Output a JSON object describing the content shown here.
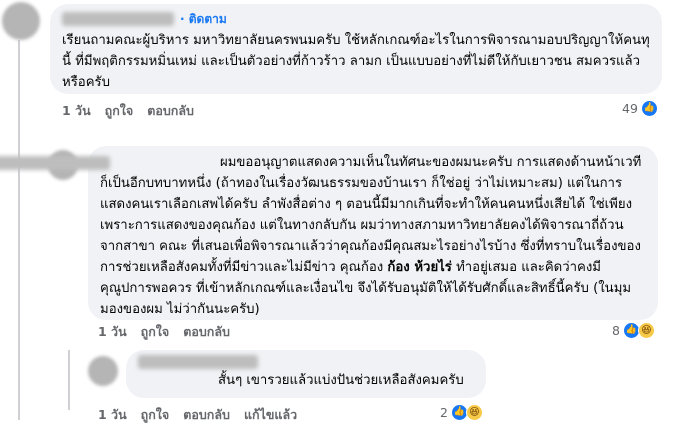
{
  "comments": [
    {
      "follow_label": "· ติดตาม",
      "text": "เรียนถามคณะผู้บริหาร มหาวิทยาลัยนครพนมครับ ใช้หลักเกณฑ์อะไรในการพิจารณามอบปริญญาให้คนทุนี้ ที่มีพฤติกรรมหมิ่นเหม่ และเป็นตัวอย่างที่ก้าวร้าว ลามก เป็นแบบอย่างที่ไม่ดีให้กับเยาวชน สมควรแล้วหรือครับ",
      "time": "1 วัน",
      "like_action": "ถูกใจ",
      "reply_action": "ตอบกลับ",
      "reaction_count": "49"
    },
    {
      "text_before": "ผมขออนุญาตแสดงความเห็นในทัศนะของผมนะครับ การแสดงด้านหน้าเวทีก็เป็นอีกบทบาทหนึ่ง (ถ้าทองในเรื่องวัฒนธรรมของบ้านเรา ก็ใช่อยู่ ว่าไม่เหมาะสม) แต่ในการแสดงคนเราเลือกเสพได้ครับ ลำพังสื่อต่าง ๆ ตอนนี้มีมากเกินที่จะทำให้คนคนหนึ่งเสียได้ ใช่เพียงเพราะการแสดงของคุณก้อง แต่ในทางกลับกัน ผมว่าทางสภามหาวิทยาลัยคงได้พิจารณาถี่ถ้วนจากสาขา คณะ ที่เสนอเพื่อพิจารณาแล้วว่าคุณก้องมีคุณสมะไรอย่างไรบ้าง ซึ่งที่ทราบในเรื่องของการช่วยเหลือสังคมทั้งที่มีข่าวและไม่มีข่าว คุณก้อง ",
      "mention": "ก้อง ห้วยไร่",
      "text_after": " ทำอยู่เสมอ และคิดว่าคงมีคุณูปการพอควร ที่เข้าหลักเกณฑ์และเงื่อนไข จึงได้รับอนุมัติให้ได้รับศักดิ์และสิทธิ์นี้ครับ (ในมุมมองของผม ไม่ว่ากันนะครับ)",
      "time": "1 วัน",
      "like_action": "ถูกใจ",
      "reply_action": "ตอบกลับ",
      "reaction_count": "8"
    },
    {
      "text": "สั้นๆ เขารวยแล้วแบ่งปันช่วยเหลือสังคมครับ",
      "time": "1 วัน",
      "like_action": "ถูกใจ",
      "reply_action": "ตอบกลับ",
      "edited_label": "แก้ไขแล้ว",
      "reaction_count": "2"
    }
  ],
  "colors": {
    "link": "#1877f2",
    "bubble": "#f0f2f5",
    "meta": "#65676b"
  },
  "icons": {
    "like": "like-reaction-icon",
    "haha": "haha-reaction-icon"
  }
}
